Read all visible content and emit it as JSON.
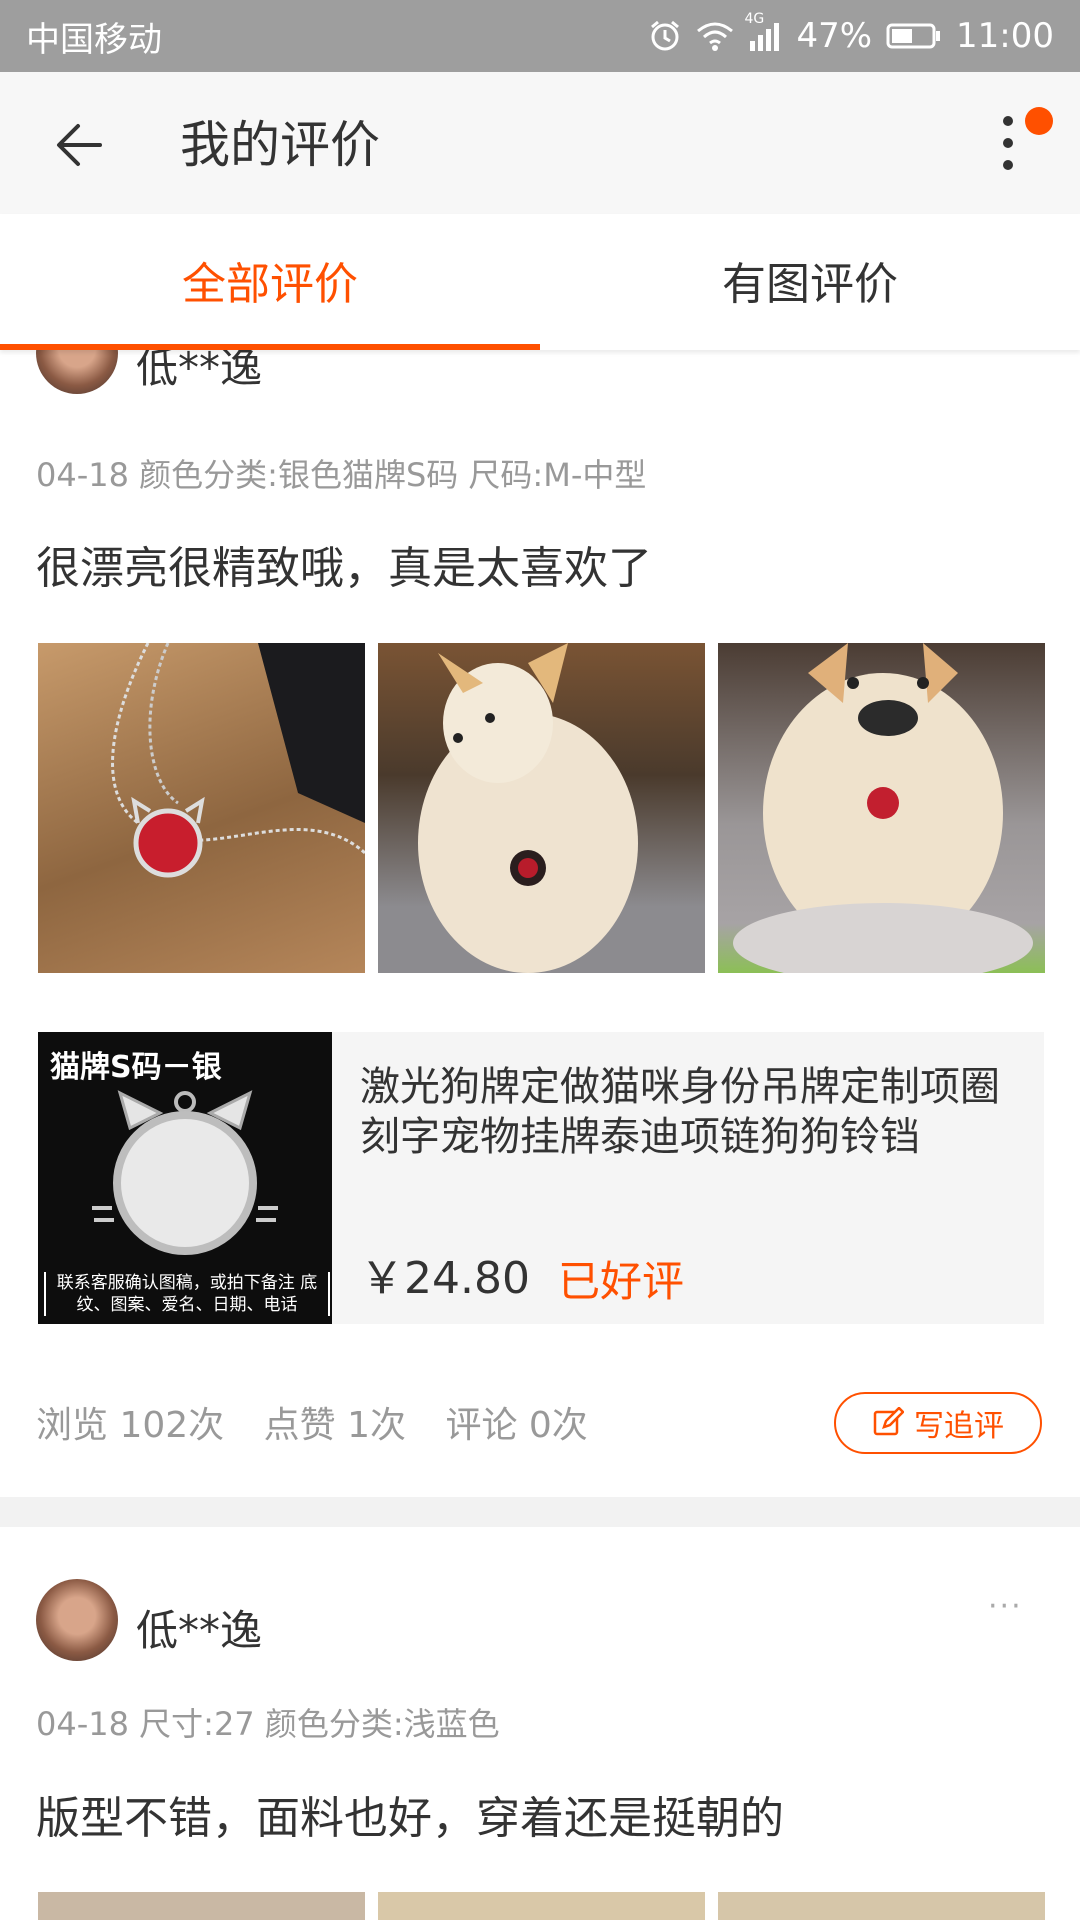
{
  "status_bar": {
    "carrier": "中国移动",
    "network": "4G",
    "battery": "47%",
    "time": "11:00",
    "icons": [
      "alarm-icon",
      "wifi-icon",
      "signal-icon",
      "battery-icon"
    ]
  },
  "header": {
    "title": "我的评价",
    "back_icon": "arrow-left-icon",
    "more_icon": "more-vertical-icon",
    "accent": "#ff5000"
  },
  "tabs": [
    {
      "label": "全部评价",
      "active": true
    },
    {
      "label": "有图评价",
      "active": false
    }
  ],
  "reviews": [
    {
      "user": "低**逸",
      "more": "···",
      "meta": "04-18  颜色分类:银色猫牌S码  尺码:M-中型",
      "text": "很漂亮很精致哦，真是太喜欢了",
      "product": {
        "thumb_title": "猫牌S码－银",
        "thumb_note": "联系客服确认图稿，或拍下备注 底纹、图案、爱名、日期、电话",
        "title": "激光狗牌定做猫咪身份吊牌定制项圈刻字宠物挂牌泰迪项链狗狗铃铛",
        "price": "￥24.80",
        "status": "已好评"
      },
      "stats": {
        "views": "浏览 102次",
        "likes": "点赞 1次",
        "comments": "评论 0次"
      },
      "follow_button": "写追评"
    },
    {
      "user": "低**逸",
      "more": "···",
      "meta": "04-18  尺寸:27  颜色分类:浅蓝色",
      "text": "版型不错，面料也好，穿着还是挺朝的"
    }
  ]
}
